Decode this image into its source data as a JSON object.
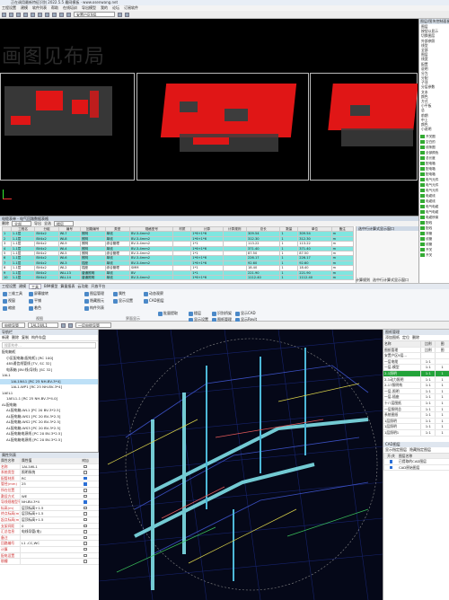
{
  "top_window": {
    "title": "正在调用最新特征识别 2022.5.5  最网模板 · www.osenwang.net",
    "menu": [
      "工程设置",
      "建模",
      "软件列表",
      "帮助",
      "在线培训",
      "导出模型",
      "我的",
      "论坛",
      "订阅软件"
    ],
    "toolbar_combo": "安置户区9层",
    "watermark": "画图见布局"
  },
  "layers_panel": {
    "header": "图层/图块控制面板",
    "items": [
      "图层",
      "按钮以显示",
      "切换图层",
      "外部参照",
      "线型",
      "全部",
      "图层",
      "线宽",
      "配置",
      "说明",
      "分为",
      "分配",
      "子项",
      "分层参数",
      "文本",
      "颜色",
      "方式",
      "小平板",
      "总",
      "前期",
      "中上",
      "颜色",
      "小说明"
    ],
    "legend": [
      "开关图",
      "空白的",
      "线条图",
      "全部颜色",
      "总长度",
      "配电箱",
      "配电箱",
      "配电箱",
      "电气元件",
      "电气元件",
      "电气元件",
      "电缆线",
      "电缆线",
      "电气电缆",
      "电气电缆",
      "电缆桥架",
      "配线",
      "配线",
      "排管",
      "线管",
      "线管",
      "开关",
      "开关"
    ]
  },
  "table_panel": {
    "title": "电缆表单 - 电气回路数据表格",
    "tools": [
      "删除",
      "全部",
      "导出",
      "全选",
      "楼层"
    ],
    "columns": [
      "",
      "工程名",
      "分组",
      "编号",
      "回路编号",
      "类型",
      "规格型号",
      "材质",
      "计算",
      "计算规则",
      "总长",
      "数量",
      "单位",
      "备注"
    ],
    "rows": [
      {
        "c": [
          "1",
          "1-1层",
          "BV4x2",
          "WL7",
          "照明",
          "单线",
          "BV-3-4mm2",
          "",
          "1*6+1*6",
          "",
          "309.54",
          "1",
          "309.54",
          "m"
        ],
        "hl": true
      },
      {
        "c": [
          "2",
          "1-1层",
          "BV4x2",
          "WL8",
          "照明",
          "单线",
          "BV-3-4mm2",
          "",
          "1*6+1*6",
          "",
          "312.30",
          "1",
          "312.30",
          "m"
        ],
        "hl": true
      },
      {
        "c": [
          "3",
          "1-1层",
          "BV4x2",
          "WL9",
          "照明",
          "综合管理",
          "BV-3-4mm2",
          "",
          "1*1",
          "",
          "113.22",
          "1",
          "113.22",
          "m"
        ],
        "hl": false
      },
      {
        "c": [
          "4",
          "1-1层",
          "BV4x2",
          "WL4",
          "照明",
          "单线",
          "BV-3-4mm2",
          "",
          "1*6+1*6",
          "",
          "371.40",
          "1",
          "371.40",
          "m"
        ],
        "hl": true
      },
      {
        "c": [
          "5",
          "1-1层",
          "BV4x2",
          "WL5",
          "照明",
          "综合管理",
          "BV-3-4mm2",
          "",
          "1*1",
          "",
          "87.50",
          "1",
          "87.50",
          "m"
        ],
        "hl": false
      },
      {
        "c": [
          "6",
          "1-1层",
          "BV4x2",
          "WL6",
          "照明",
          "单线",
          "BV-3-4mm2",
          "",
          "1*6+1*6",
          "",
          "226.17",
          "1",
          "226.17",
          "m"
        ],
        "hl": true
      },
      {
        "c": [
          "7",
          "1-1层",
          "BV4x2",
          "WL3",
          "插座",
          "单线",
          "BV-3-4mm2",
          "",
          "1*6+1*6",
          "",
          "92.60",
          "1",
          "92.60",
          "m"
        ],
        "hl": true
      },
      {
        "c": [
          "8",
          "1-1层",
          "BV4x2",
          "WL2",
          "插座",
          "综合管理",
          "SMM",
          "",
          "1*1",
          "",
          "18.40",
          "1",
          "18.40",
          "m"
        ],
        "hl": false
      },
      {
        "c": [
          "9",
          "1-1层",
          "BV4x2",
          "WLL13",
          "普通照明",
          "单线",
          "BV",
          "",
          "1*1",
          "",
          "221.90",
          "1",
          "221.90",
          "m"
        ],
        "hl": true
      },
      {
        "c": [
          "10",
          "1-1层",
          "BV4x2",
          "WLL14",
          "普通照明",
          "单线",
          "BV-3-4mm2",
          "",
          "1*6+1*6",
          "",
          "1112.40",
          "1",
          "1112.40",
          "m"
        ],
        "hl": true
      }
    ],
    "side_title": "选中行计算式显示窗口",
    "footer_tabs": [
      "计算规则",
      "选中行计算式显示窗口"
    ]
  },
  "ribbon": {
    "tabs": [
      "工程设置",
      "建模",
      "工具",
      "BIM模型",
      "算量报表",
      "云功能",
      "开放平台"
    ],
    "buttons": {
      "b1": "三维工具",
      "b2": "屏幕旋转",
      "b3": "视窗",
      "b4": "平铺",
      "b5": "缩放",
      "b6": "着色",
      "b7": "图层管理",
      "b8": "隐藏图元",
      "b9": "构件列表",
      "b10": "属性",
      "b11": "显示设置",
      "b12": "动态观察",
      "b13": "CAD图层",
      "b14": "批量提取",
      "b15": "楼层",
      "b16": "识别桥架",
      "b17": "显示CAD",
      "b18": "图纸管理",
      "b19": "显示Revit",
      "b20": "显示设置"
    },
    "groups": [
      "视图",
      "界面显示"
    ]
  },
  "bottom_window": {
    "toolbar_combo1": "电缆导管",
    "toolbar_combo2": "1AL1WL1",
    "toolbar_combo3": "一层电缆导管",
    "tree": {
      "header": "导航栏",
      "tools": [
        "新建",
        "删除",
        "复制",
        "构件存盘"
      ],
      "search": "搜索构件...",
      "items": [
        {
          "t": "配电箱柜",
          "lvl": 0,
          "sel": false
        },
        {
          "t": "小区配电箱(配电柜) [RC 100]",
          "lvl": 1,
          "sel": false
        },
        {
          "t": "485通信线管线 [TV, SC 32]",
          "lvl": 1,
          "sel": false
        },
        {
          "t": "电表箱 [BV:线(导线) [SC 32]",
          "lvl": 1,
          "sel": false
        },
        {
          "t": "1AL1",
          "lvl": 0,
          "sel": false
        },
        {
          "t": "1AL1WL1 [RC 25 NH-BV-3*4]",
          "lvl": 2,
          "sel": true
        },
        {
          "t": "1AL1-WP1 [RC 25 NH-BV-3*4]",
          "lvl": 2,
          "sel": false
        },
        {
          "t": "1AEL1",
          "lvl": 0,
          "sel": false
        },
        {
          "t": "1AEL1-1 [RC 25 NH-BV-3*4.0]",
          "lvl": 1,
          "sel": false
        },
        {
          "t": "AL配电箱",
          "lvl": 0,
          "sel": false
        },
        {
          "t": "AL配电箱-WL1 [PC 20 BV-3*2.5]",
          "lvl": 1,
          "sel": false
        },
        {
          "t": "AL配电箱-WS1 [PC 20 BV-3*2.5]",
          "lvl": 1,
          "sel": false
        },
        {
          "t": "AL配电箱-WS2 [PC 20 BV-3*2.5]",
          "lvl": 1,
          "sel": false
        },
        {
          "t": "AL配电箱-WS3 [PC 20 BV-3*2.5]",
          "lvl": 1,
          "sel": false
        },
        {
          "t": "AL配电箱电源线 [PC 20 BV-3*2.5]",
          "lvl": 1,
          "sel": false
        },
        {
          "t": "AL配电箱电源线 [PC 20 BV-3*2.5]",
          "lvl": 1,
          "sel": false
        }
      ]
    },
    "properties": {
      "header": "属性列表",
      "cols": [
        "属性名称",
        "属性值",
        "附加"
      ],
      "rows": [
        {
          "k": "名称",
          "v": "1AL1WL1",
          "on": false
        },
        {
          "k": "系统类型",
          "v": "照明系统",
          "on": false
        },
        {
          "k": "配管材质",
          "v": "RC",
          "on": true
        },
        {
          "k": "管径(mm)",
          "v": "25",
          "on": true
        },
        {
          "k": "所在位置",
          "v": "",
          "on": false
        },
        {
          "k": "敷设方式",
          "v": "WE",
          "on": false
        },
        {
          "k": "导线规格型号",
          "v": "NH-BV-3*4",
          "on": true
        },
        {
          "k": "标高(m)",
          "v": "层顶标高+1.5",
          "on": false
        },
        {
          "k": "终点标高(m)",
          "v": "层顶标高+1.5",
          "on": false
        },
        {
          "k": "起点标高(m)",
          "v": "层顶标高+1.5",
          "on": false
        },
        {
          "k": "支架间距",
          "v": "0",
          "on": false
        },
        {
          "k": "汇总信息",
          "v": "电线导管(电)",
          "on": false
        },
        {
          "k": "备注",
          "v": "",
          "on": false
        },
        {
          "k": "回路编号",
          "v": "L1 -CC,WC",
          "on": false
        },
        {
          "k": "计算",
          "v": "",
          "on": false
        },
        {
          "k": "配电设置",
          "v": "",
          "on": false
        },
        {
          "k": "剔槽",
          "v": "",
          "on": false
        }
      ]
    },
    "layers": {
      "header": "图纸管理",
      "tools": [
        "添加图纸",
        "定位",
        "删除"
      ],
      "cols": [
        "名称",
        "比例",
        "图"
      ],
      "rows": [
        {
          "n": "图纸管理",
          "a": "比例",
          "b": "图",
          "g": false
        },
        {
          "n": "安置户区9层...",
          "a": "",
          "b": "",
          "g": false
        },
        {
          "n": "一层电缆",
          "a": "1:1",
          "b": "",
          "g": false
        },
        {
          "n": "一层-模型",
          "a": "1:1",
          "b": "1",
          "g": false
        },
        {
          "n": "2-1照明",
          "a": "1:1",
          "b": "1",
          "g": true
        },
        {
          "n": "2-1动力照明",
          "a": "1:1",
          "b": "1",
          "g": false
        },
        {
          "n": "2-17照明构",
          "a": "1:1",
          "b": "1",
          "g": false
        },
        {
          "n": "一层-照明",
          "a": "1:1",
          "b": "1",
          "g": false
        },
        {
          "n": "一层-插座",
          "a": "1:1",
          "b": "1",
          "g": false
        },
        {
          "n": "十八层图纸",
          "a": "1:1",
          "b": "1",
          "g": false
        },
        {
          "n": "一层照明总",
          "a": "1:1",
          "b": "1",
          "g": false
        },
        {
          "n": "系统图纸",
          "a": "1:1",
          "b": "1",
          "g": false
        },
        {
          "n": "1层照明",
          "a": "1:1",
          "b": "1",
          "g": false
        },
        {
          "n": "1层照明",
          "a": "1:1",
          "b": "1",
          "g": false
        },
        {
          "n": "1层照明1",
          "a": "1:1",
          "b": "1",
          "g": false
        }
      ],
      "cad_header": "CAD图层",
      "cad_tools": [
        "显示指定图层",
        "隐藏指定图层"
      ],
      "cad_cols": [
        "开/关",
        "图层名称"
      ],
      "cad_rows": [
        {
          "n": "已提取的CAD图层",
          "on": true
        },
        {
          "n": "CAD原始图层",
          "on": true
        }
      ]
    }
  }
}
